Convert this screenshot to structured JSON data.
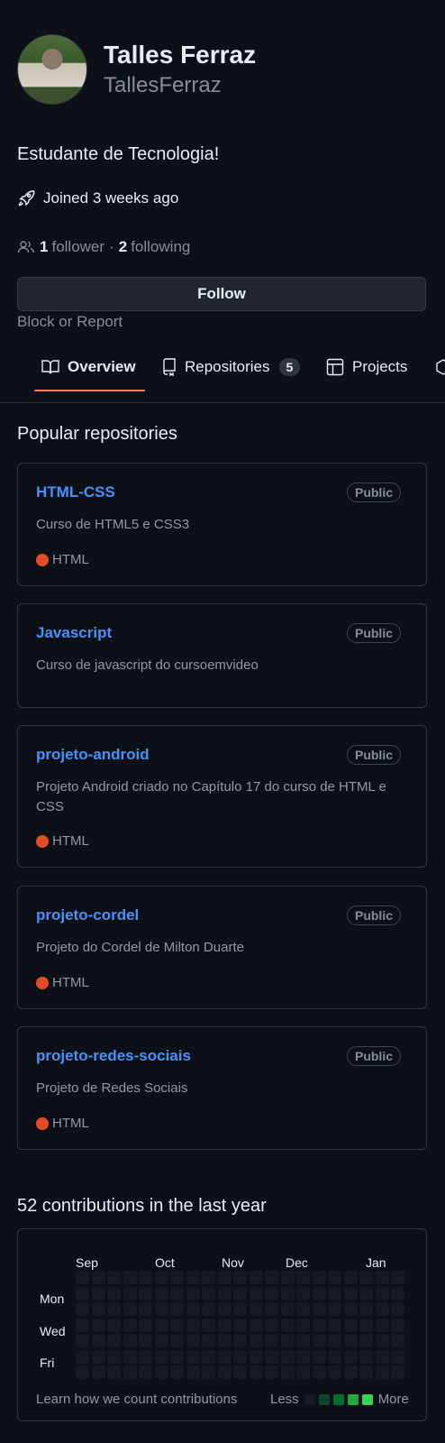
{
  "profile": {
    "fullname": "Talles Ferraz",
    "login": "TallesFerraz",
    "bio": "Estudante de Tecnologia!",
    "joined": "Joined 3 weeks ago",
    "followers_count": "1",
    "followers_label": "follower",
    "separator": "·",
    "following_count": "2",
    "following_label": "following",
    "follow_button": "Follow",
    "block_link": "Block or Report"
  },
  "tabs": {
    "overview": "Overview",
    "repositories": "Repositories",
    "repositories_count": "5",
    "projects": "Projects"
  },
  "popular": {
    "title": "Popular repositories",
    "badge": "Public",
    "repos": [
      {
        "name": "HTML-CSS",
        "desc": "Curso de HTML5 e CSS3",
        "lang": "HTML"
      },
      {
        "name": "Javascript",
        "desc": "Curso de javascript do cursoemvideo",
        "lang": ""
      },
      {
        "name": "projeto-android",
        "desc": "Projeto Android criado no Capítulo 17 do curso de HTML e CSS",
        "lang": "HTML"
      },
      {
        "name": "projeto-cordel",
        "desc": "Projeto do Cordel de Milton Duarte",
        "lang": "HTML"
      },
      {
        "name": "projeto-redes-sociais",
        "desc": "Projeto de Redes Sociais",
        "lang": "HTML"
      }
    ]
  },
  "contributions": {
    "title": "52 contributions in the last year",
    "months": [
      "Sep",
      "Oct",
      "Nov",
      "Dec",
      "Jan"
    ],
    "days": [
      "Mon",
      "Wed",
      "Fri"
    ],
    "learn_link": "Learn how we count contributions",
    "less": "Less",
    "more": "More",
    "legend_colors": [
      "#161b22",
      "#0e4429",
      "#006d32",
      "#26a641",
      "#39d353"
    ]
  },
  "colors": {
    "accent_link": "#4493f8",
    "tab_underline": "#f78166",
    "html_lang": "#e34c26"
  }
}
